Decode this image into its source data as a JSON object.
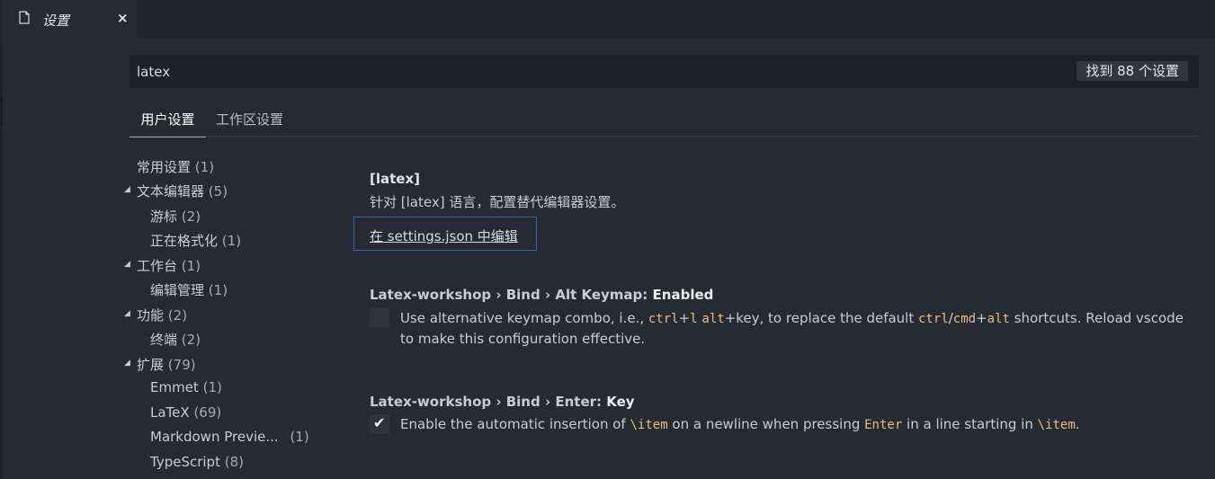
{
  "tab": {
    "title": "设置",
    "close": "×"
  },
  "search": {
    "value": "latex",
    "result_count": "找到 88 个设置"
  },
  "scope_tabs": {
    "user": "用户设置",
    "workspace": "工作区设置"
  },
  "toc": [
    {
      "label": "常用设置",
      "count": "(1)"
    },
    {
      "label": "文本编辑器",
      "count": "(5)"
    },
    {
      "label": "游标",
      "count": "(2)"
    },
    {
      "label": "正在格式化",
      "count": "(1)"
    },
    {
      "label": "工作台",
      "count": "(1)"
    },
    {
      "label": "编辑管理",
      "count": "(1)"
    },
    {
      "label": "功能",
      "count": "(2)"
    },
    {
      "label": "终端",
      "count": "(2)"
    },
    {
      "label": "扩展",
      "count": "(79)"
    },
    {
      "label": "Emmet",
      "count": "(1)"
    },
    {
      "label": "LaTeX",
      "count": "(69)"
    },
    {
      "label": "Markdown Previe...",
      "count": "(1)"
    },
    {
      "label": "TypeScript",
      "count": "(8)"
    }
  ],
  "section": {
    "title": "[latex]",
    "description": "针对 [latex] 语言，配置替代编辑器设置。",
    "edit_link": "在 settings.json 中编辑"
  },
  "settings": [
    {
      "category": "Latex-workshop › Bind › Alt Keymap: ",
      "name": "Enabled",
      "checked": false,
      "desc": {
        "t1": "Use alternative keymap combo, i.e., ",
        "c1": "ctrl",
        "t2": "+",
        "c2": "l",
        "t3": " ",
        "c3": "alt",
        "t4": "+key, to replace the default ",
        "c4": "ctrl",
        "t5": "/",
        "c5": "cmd",
        "t6": "+",
        "c6": "alt",
        "t7": " shortcuts. Reload vscode to make this configuration effective."
      }
    },
    {
      "category": "Latex-workshop › Bind › Enter: ",
      "name": "Key",
      "checked": true,
      "check_glyph": "✔",
      "desc": {
        "t1": "Enable the automatic insertion of ",
        "c1": "\\item",
        "t2": " on a newline when pressing ",
        "c2": "Enter",
        "t3": " in a line starting in ",
        "c3": "\\item",
        "t4": "."
      }
    }
  ],
  "colors": {
    "background": "#262b33",
    "tabbar": "#21252b",
    "code": "#e5c07b",
    "focus_border": "#3f5fb0"
  }
}
